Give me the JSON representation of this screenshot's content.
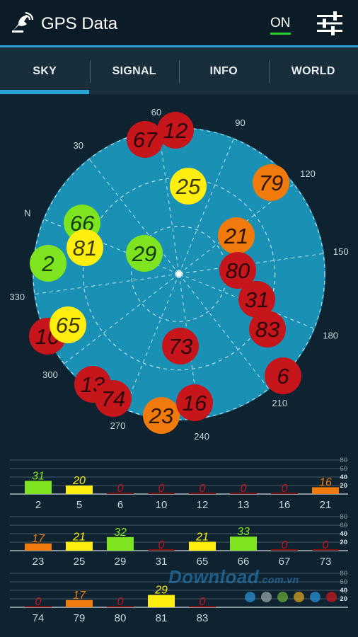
{
  "app": {
    "title": "GPS Data",
    "gps_toggle": "ON",
    "logo_icon": "satellite-dish-icon",
    "settings_icon": "sliders-icon"
  },
  "tabs": [
    {
      "label": "SKY",
      "active": true
    },
    {
      "label": "SIGNAL",
      "active": false
    },
    {
      "label": "INFO",
      "active": false
    },
    {
      "label": "WORLD",
      "active": false
    }
  ],
  "colors": {
    "accent": "#2aa3d3",
    "sky_disc": "#1a90b5",
    "red": "#c7151c",
    "orange": "#f07a0b",
    "yellow": "#ffee10",
    "green": "#7ee41f"
  },
  "sky": {
    "bearing_labels": [
      "N",
      "30",
      "60",
      "90",
      "120",
      "150",
      "180",
      "210",
      "240",
      "270",
      "300",
      "330"
    ],
    "satellites": [
      {
        "id": "67",
        "color": "red"
      },
      {
        "id": "12",
        "color": "red"
      },
      {
        "id": "25",
        "color": "yellow"
      },
      {
        "id": "79",
        "color": "orange"
      },
      {
        "id": "66",
        "color": "green"
      },
      {
        "id": "81",
        "color": "yellow"
      },
      {
        "id": "2",
        "color": "green"
      },
      {
        "id": "29",
        "color": "green"
      },
      {
        "id": "21",
        "color": "orange"
      },
      {
        "id": "80",
        "color": "red"
      },
      {
        "id": "31",
        "color": "red"
      },
      {
        "id": "83",
        "color": "red"
      },
      {
        "id": "10",
        "color": "red"
      },
      {
        "id": "65",
        "color": "yellow"
      },
      {
        "id": "73",
        "color": "red"
      },
      {
        "id": "13",
        "color": "red"
      },
      {
        "id": "74",
        "color": "red"
      },
      {
        "id": "6",
        "color": "red"
      },
      {
        "id": "23",
        "color": "orange"
      },
      {
        "id": "16",
        "color": "red"
      }
    ]
  },
  "chart_data": {
    "type": "bar",
    "y_ticks": [
      "80",
      "60",
      "40",
      "20"
    ],
    "ylim": [
      0,
      80
    ],
    "rows": [
      {
        "categories": [
          "2",
          "5",
          "6",
          "10",
          "12",
          "13",
          "16",
          "21"
        ],
        "values": [
          31,
          20,
          0,
          0,
          0,
          0,
          0,
          16
        ],
        "labels": [
          "31",
          "20",
          "0",
          "0",
          "0",
          "0",
          "0",
          "16"
        ]
      },
      {
        "categories": [
          "23",
          "25",
          "29",
          "31",
          "65",
          "66",
          "67",
          "73"
        ],
        "values": [
          17,
          21,
          32,
          0,
          21,
          33,
          0,
          0
        ],
        "labels": [
          "17",
          "21",
          "32",
          "0",
          "21",
          "33",
          "0",
          "0"
        ]
      },
      {
        "categories": [
          "74",
          "79",
          "80",
          "81",
          "83"
        ],
        "values": [
          0,
          17,
          0,
          29,
          0
        ],
        "labels": [
          "0",
          "17",
          "0",
          "29",
          "0"
        ]
      }
    ]
  },
  "watermark": {
    "brand": "Download",
    "suffix": ".com.vn",
    "dot_colors": [
      "#2a8fd0",
      "#9aa3a8",
      "#6aa83a",
      "#d6a020",
      "#2a8fd0",
      "#c7151c"
    ]
  }
}
